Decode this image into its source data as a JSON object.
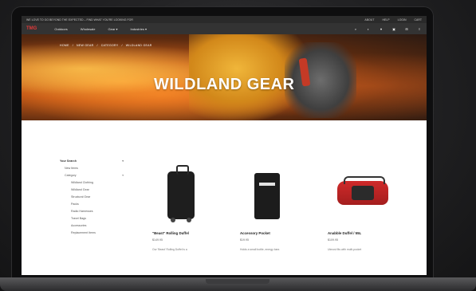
{
  "topbar": {
    "left_text": "WE LOVE TO GO BEYOND THE EXPECTED – FIND WHAT YOU'RE LOOKING FOR",
    "links": [
      "ABOUT",
      "HELP",
      "LOGIN",
      "CART"
    ]
  },
  "navbar": {
    "brand": "TMG",
    "items": [
      "Outdoors",
      "Wholesale",
      "Gear ▾",
      "Industries ▾"
    ],
    "icons": [
      "search-icon",
      "user-icon",
      "heart-icon",
      "bag-icon",
      "cart-icon",
      "menu-icon"
    ]
  },
  "hero": {
    "breadcrumb": [
      "HOME",
      "/",
      "NEW GEAR",
      "/",
      "CATEGORY",
      "/",
      "WILDLAND GEAR"
    ],
    "title": "WILDLAND GEAR"
  },
  "sidebar": {
    "items": [
      {
        "label": "Your Search",
        "level": 0,
        "chev": "▾"
      },
      {
        "label": "New Items",
        "level": 1,
        "chev": ""
      },
      {
        "label": "Category",
        "level": 1,
        "chev": "▾"
      },
      {
        "label": "Wildland Clothing",
        "level": 2,
        "chev": ""
      },
      {
        "label": "Wildland Gear",
        "level": 2,
        "chev": ""
      },
      {
        "label": "Structural Gear",
        "level": 2,
        "chev": ""
      },
      {
        "label": "Packs",
        "level": 2,
        "chev": ""
      },
      {
        "label": "Radio Harnesses",
        "level": 2,
        "chev": ""
      },
      {
        "label": "Travel Bags",
        "level": 2,
        "chev": ""
      },
      {
        "label": "Accessories",
        "level": 2,
        "chev": ""
      },
      {
        "label": "Replacement Items",
        "level": 2,
        "chev": ""
      }
    ]
  },
  "products": [
    {
      "name": "\"Beast\" Rolling Duffel",
      "price": "$149.95",
      "desc": "Our 'Beast' Rolling Duffel is a"
    },
    {
      "name": "Accessory Pocket",
      "price": "$19.95",
      "desc": "Holds a small bottle, energy bars"
    },
    {
      "name": "Anabble Duffel / 55L",
      "price": "$109.95",
      "desc": "Utmost fits with multi-pocket"
    }
  ]
}
